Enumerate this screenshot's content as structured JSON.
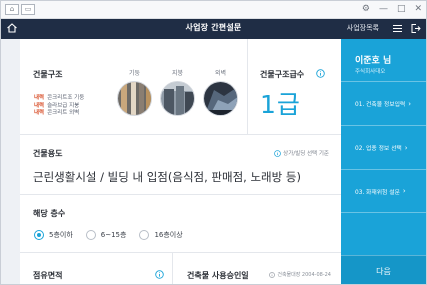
{
  "window": {
    "left_buttons": [
      "⌂",
      "▭"
    ],
    "right_icons": [
      "settings-icon",
      "minimize-icon",
      "maximize-icon",
      "close-icon"
    ]
  },
  "appbar": {
    "title": "사업장 간편설문",
    "list_link": "사업장목록"
  },
  "structure": {
    "title": "건물구조",
    "legend": [
      {
        "key": "내력",
        "text": "콘크리트조 기둥"
      },
      {
        "key": "내력",
        "text": "슬라브급 지붕"
      },
      {
        "key": "내력",
        "text": "콘크리트 외벽"
      }
    ],
    "thumbs": [
      {
        "caption": "기둥"
      },
      {
        "caption": "지붕"
      },
      {
        "caption": "외벽"
      }
    ]
  },
  "grade": {
    "title": "건물구조급수",
    "value": "1급"
  },
  "usage": {
    "title": "건물용도",
    "hint": "상가/빌딩 선택 기준",
    "value": "근린생활시설 / 빌딩 내 입점(음식점, 판매점, 노래방 등)"
  },
  "floors": {
    "title": "해당 층수",
    "options": [
      {
        "label": "5층이하",
        "selected": true
      },
      {
        "label": "6~15층",
        "selected": false
      },
      {
        "label": "16층이상",
        "selected": false
      }
    ]
  },
  "area": {
    "title": "점유면적"
  },
  "approval": {
    "title": "건축물 사용승인일",
    "date": "건축물대장 2004-08-24"
  },
  "sidebar": {
    "user": "이준호 님",
    "company": "주식회사대오",
    "steps": [
      {
        "label": "01. 건축물 정보입력"
      },
      {
        "label": "02. 업종 정보 선택"
      },
      {
        "label": "03. 화재위험 설문"
      }
    ],
    "next_label": "다음"
  },
  "colors": {
    "navy": "#1f2d45",
    "accent": "#1aa3d8",
    "legend_key": "#d9532f"
  }
}
